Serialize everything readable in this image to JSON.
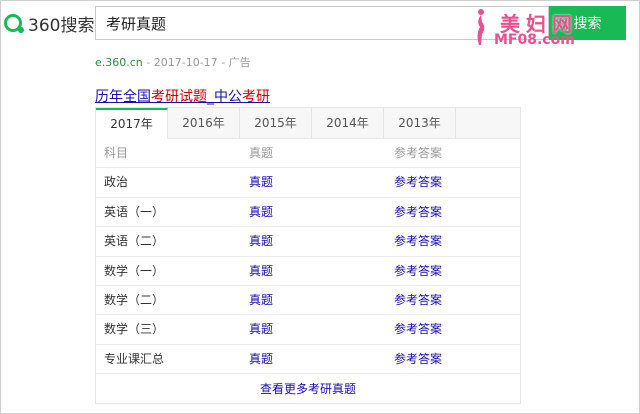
{
  "header": {
    "logo_text": "360搜索",
    "search_value": "考研真题",
    "search_button": "搜索"
  },
  "watermark": {
    "title": "美妇网",
    "url": "MF08.com"
  },
  "ad": {
    "source_url": "e.360.cn",
    "date": "- 2017-10-17",
    "tag": "- 广告",
    "title_parts": [
      "历年全国",
      "考研试题",
      "_中公",
      "考研"
    ]
  },
  "card": {
    "tabs": [
      "2017年",
      "2016年",
      "2015年",
      "2014年",
      "2013年"
    ],
    "active_tab": 0,
    "columns": [
      "科目",
      "真题",
      "参考答案"
    ],
    "rows": [
      {
        "subject": "政治",
        "exam": "真题",
        "answer": "参考答案"
      },
      {
        "subject": "英语（一）",
        "exam": "真题",
        "answer": "参考答案"
      },
      {
        "subject": "英语（二）",
        "exam": "真题",
        "answer": "参考答案"
      },
      {
        "subject": "数学（一）",
        "exam": "真题",
        "answer": "参考答案"
      },
      {
        "subject": "数学（二）",
        "exam": "真题",
        "answer": "参考答案"
      },
      {
        "subject": "数学（三）",
        "exam": "真题",
        "answer": "参考答案"
      },
      {
        "subject": "专业课汇总",
        "exam": "真题",
        "answer": "参考答案"
      }
    ],
    "more_link": "查看更多考研真题"
  },
  "colors": {
    "brand_green": "#19b955",
    "link_blue": "#1a0dab",
    "highlight_red": "#cc0000",
    "watermark_pink": "#e8508f"
  }
}
